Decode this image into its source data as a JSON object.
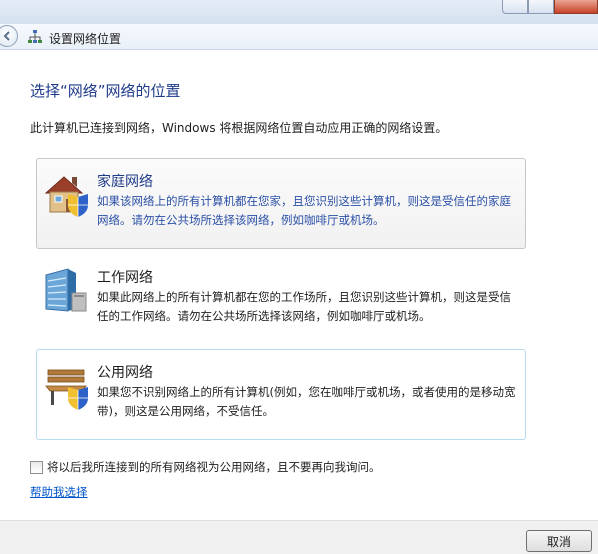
{
  "header": {
    "title": "设置网络位置"
  },
  "main": {
    "title": "选择“网络”网络的位置",
    "description": "此计算机已连接到网络，Windows 将根据网络位置自动应用正确的网络设置。"
  },
  "options": [
    {
      "title": "家庭网络",
      "text": "如果该网络上的所有计算机都在您家，且您识别这些计算机，则这是受信任的家庭网络。请勿在公共场所选择该网络，例如咖啡厅或机场。",
      "icon": "house-shield-icon"
    },
    {
      "title": "工作网络",
      "text": "如果此网络上的所有计算机都在您的工作场所，且您识别这些计算机，则这是受信任的工作网络。请勿在公共场所选择该网络，例如咖啡厅或机场。",
      "icon": "office-building-icon"
    },
    {
      "title": "公用网络",
      "text": "如果您不识别网络上的所有计算机(例如，您在咖啡厅或机场，或者使用的是移动宽带)，则这是公用网络，不受信任。",
      "icon": "park-bench-shield-icon"
    }
  ],
  "checkbox": {
    "label": "将以后我所连接到的所有网络视为公用网络，且不要再向我询问。",
    "checked": false
  },
  "help_link": "帮助我选择",
  "footer": {
    "cancel_label": "取消"
  }
}
